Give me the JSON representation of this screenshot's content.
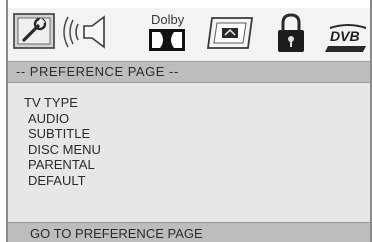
{
  "icon_bar": {
    "icons": [
      "settings-icon",
      "speaker-audio-icon",
      "dolby-icon",
      "video-screen-icon",
      "lock-icon",
      "dvb-icon"
    ],
    "dolby_label": "Dolby",
    "dvb_label": "DVB"
  },
  "page_title": "-- PREFERENCE PAGE --",
  "menu": {
    "items": [
      "TV TYPE",
      "AUDIO",
      "SUBTITLE",
      "DISC MENU",
      "PARENTAL",
      "DEFAULT"
    ]
  },
  "status": "GO TO PREFERENCE PAGE",
  "colors": {
    "background": "#d6d6d6",
    "icon_bar": "#f3f3f3",
    "title_bar": "#bdbdbd",
    "menu_panel": "#e7e7e7",
    "text": "#2c2c2c"
  }
}
